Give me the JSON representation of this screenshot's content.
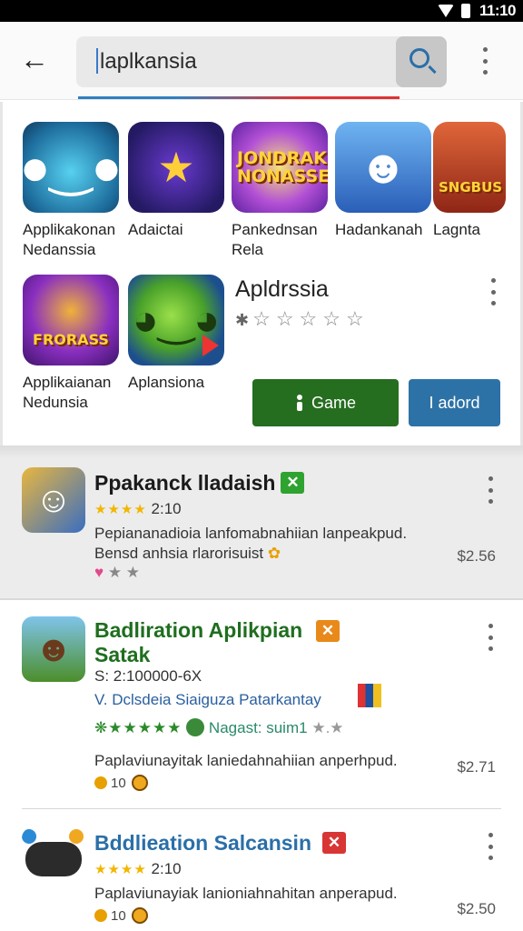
{
  "status_bar": {
    "time": "11:10"
  },
  "search": {
    "query": "laplkansia"
  },
  "top_apps": [
    {
      "label": "Applikakonan Nedanssia",
      "icon": "cute-monster-icon",
      "bg": "#3aa3c4"
    },
    {
      "label": "Adaictai",
      "icon": "star-fireworks-icon",
      "bg": "#2b1f6e"
    },
    {
      "label": "Pankednsan Rela",
      "icon": "jondrak-logo-icon",
      "bg": "#8a3dc9",
      "art_text": "JONDRAK NONASSE"
    },
    {
      "label": "Hadankanah",
      "icon": "blue-hero-icon",
      "bg": "#4a7fd6"
    },
    {
      "label": "Lagnta",
      "icon": "robot-fighter-icon",
      "bg": "#c9492a",
      "art_text": "SNGBUS"
    },
    {
      "label": "Applikaianan Nedunsia",
      "icon": "warrior-icon",
      "bg": "#7a2fb0",
      "art_text": "FRORASS"
    },
    {
      "label": "Aplansiona",
      "icon": "green-alien-icon",
      "bg": "#1f5fa0"
    }
  ],
  "featured": {
    "title": "Apldrssia",
    "stars": "☆☆☆☆☆",
    "game_button": "Game",
    "load_button": "I adord"
  },
  "list": [
    {
      "title": "Ppakanck lladaish",
      "tag_color": "#2fa32f",
      "rating": "2:10",
      "desc1": "Pepiananadioia lanfomabnahiian lanpeakpud.",
      "desc2": "Bensd anhsia rlarorisuist",
      "price": "$2.56",
      "accent": "#2a6fa8"
    },
    {
      "title": "Badliration Aplikpian Satak",
      "tag_color": "#e8891a",
      "meta": "S: 2:100000-6X",
      "dev": "V. Dclsdeia Siaiguza Patarkantay",
      "badge": "Nagast: suim1",
      "desc1": "Paplaviunayitak laniedahnahiian anperhpud.",
      "coins": "10",
      "price": "$2.71",
      "accent": "#1f7a1f"
    },
    {
      "title": "Bddlieation Salcansin",
      "tag_color": "#d83535",
      "rating": "2:10",
      "desc1": "Paplaviunayiak lanioniahnahitan anperapud.",
      "coins": "10",
      "price": "$2.50",
      "accent": "#2a6fa8"
    }
  ]
}
